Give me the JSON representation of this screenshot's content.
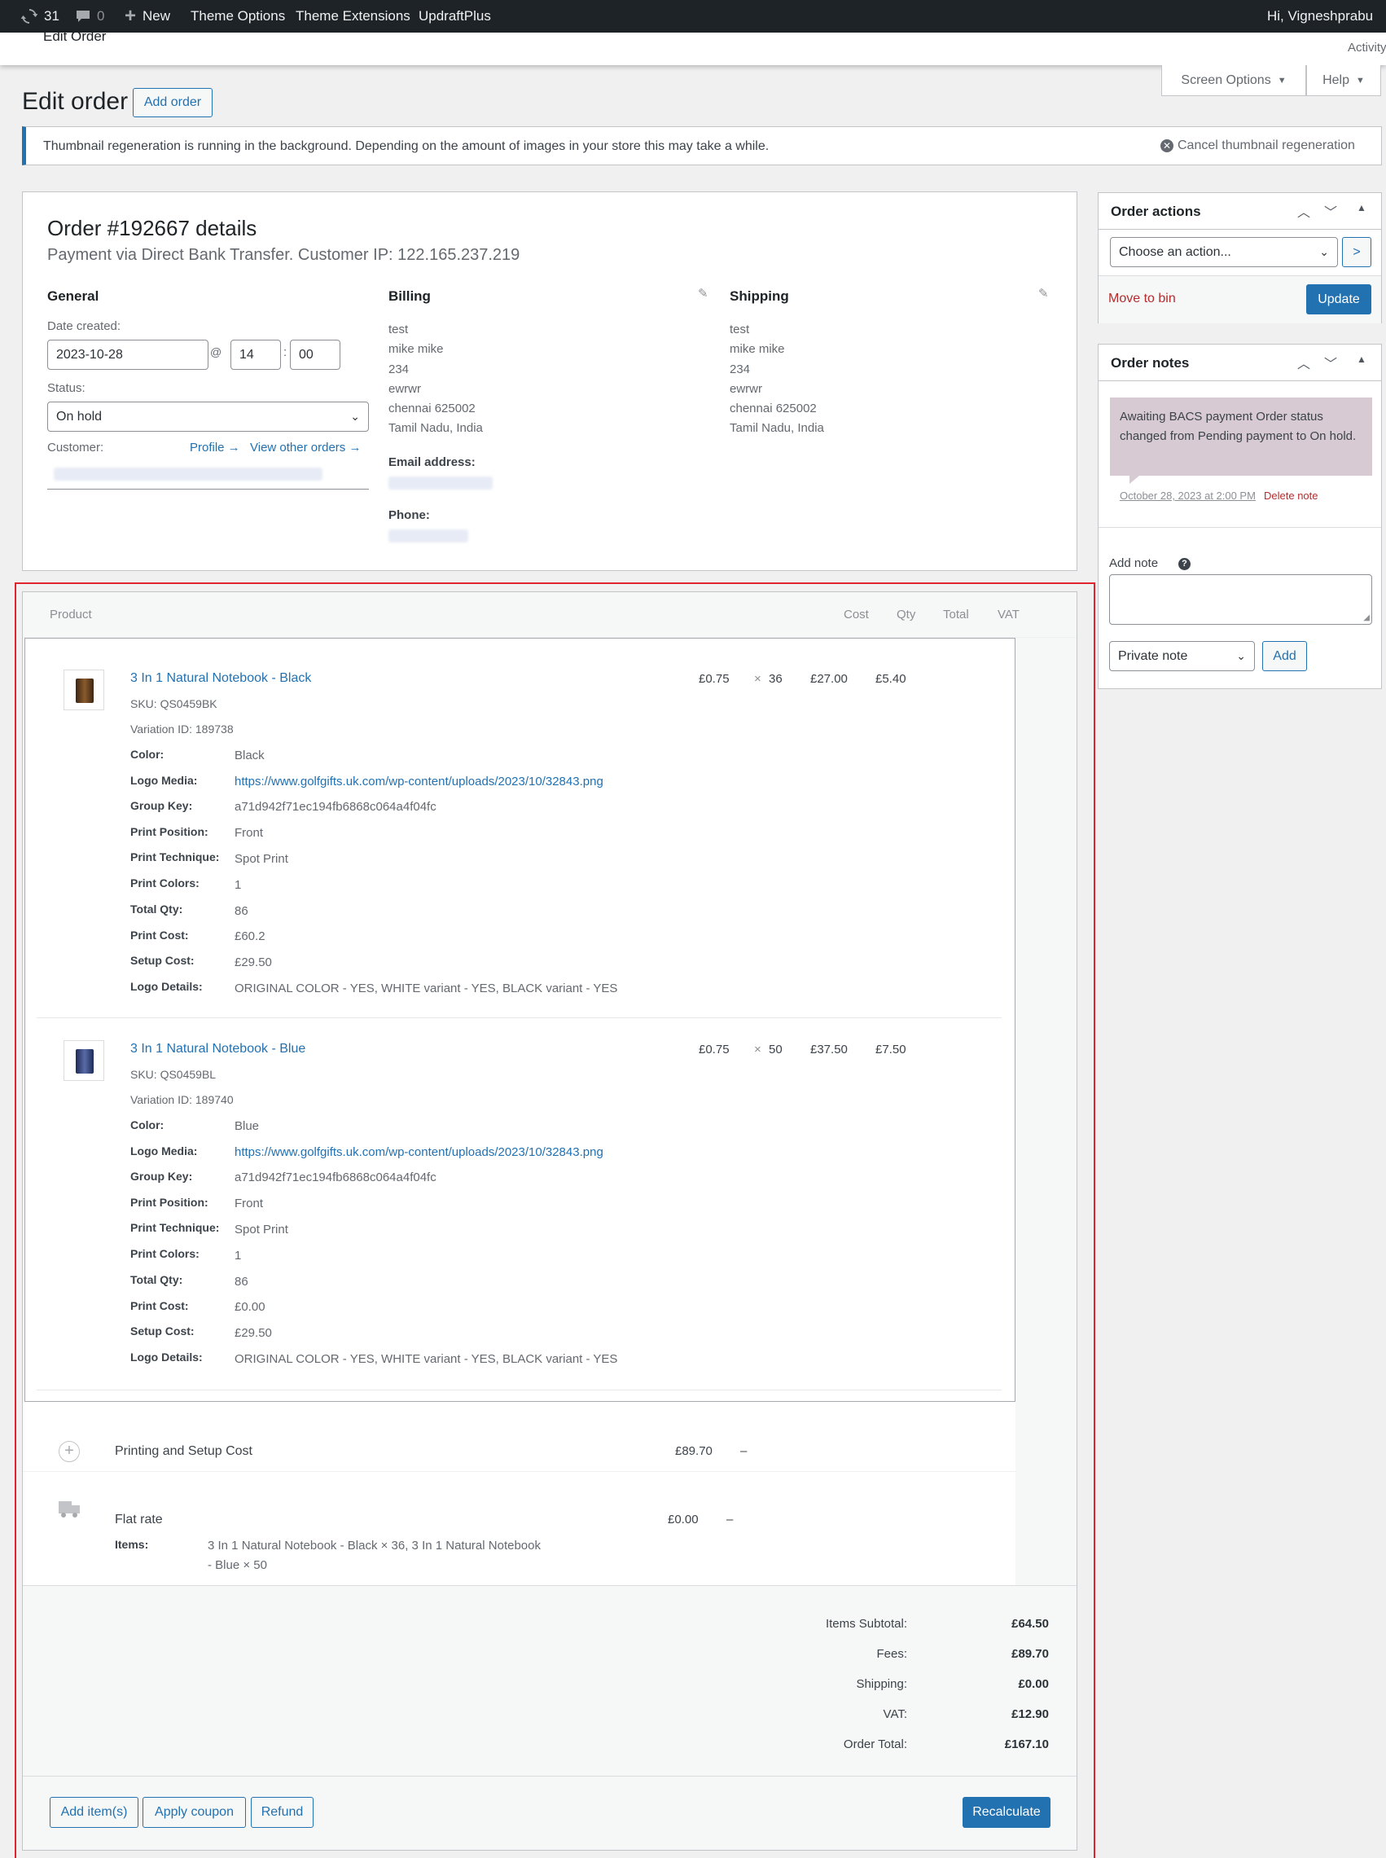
{
  "admin_bar": {
    "updates_count": "31",
    "comments_count": "0",
    "new_label": "New",
    "theme_options": "Theme Options",
    "theme_extensions": "Theme Extensions",
    "updraft": "UpdraftPlus",
    "greeting": "Hi, Vigneshprabu"
  },
  "sub_bar": {
    "title": "Edit Order",
    "activity": "Activity"
  },
  "screen_options": "Screen Options",
  "help": "Help",
  "page_title": "Edit order",
  "add_order": "Add order",
  "notice": {
    "text": "Thumbnail regeneration is running in the background. Depending on the amount of images in your store this may take a while.",
    "cancel": "Cancel thumbnail regeneration"
  },
  "order": {
    "heading": "Order #192667 details",
    "subheading": "Payment via Direct Bank Transfer. Customer IP: 122.165.237.219",
    "general": {
      "title": "General",
      "date_label": "Date created:",
      "date": "2023-10-28",
      "at": "@",
      "hour": "14",
      "colon": ":",
      "minute": "00",
      "status_label": "Status:",
      "status": "On hold",
      "customer_label": "Customer:",
      "profile_link": "Profile →",
      "other_orders_link": "View other orders →"
    },
    "billing": {
      "title": "Billing",
      "lines": [
        "test",
        "mike mike",
        "234",
        "ewrwr",
        "chennai 625002",
        "Tamil Nadu, India"
      ],
      "email_label": "Email address:",
      "phone_label": "Phone:"
    },
    "shipping": {
      "title": "Shipping",
      "lines": [
        "test",
        "mike mike",
        "234",
        "ewrwr",
        "chennai 625002",
        "Tamil Nadu, India"
      ]
    }
  },
  "items_table": {
    "headers": {
      "product": "Product",
      "cost": "Cost",
      "qty": "Qty",
      "total": "Total",
      "vat": "VAT"
    },
    "items": [
      {
        "name": "3 In 1 Natural Notebook - Black",
        "sku_label": "SKU:",
        "sku": "QS0459BK",
        "variation_label": "Variation ID:",
        "variation": "189738",
        "cost": "£0.75",
        "times": "×",
        "qty": "36",
        "total": "£27.00",
        "vat": "£5.40",
        "thumb_color": "#5a3a22",
        "meta": [
          [
            "Color:",
            "Black"
          ],
          [
            "Logo Media:",
            "https://www.golfgifts.uk.com/wp-content/uploads/2023/10/32843.png"
          ],
          [
            "Group Key:",
            "a71d942f71ec194fb6868c064a4f04fc"
          ],
          [
            "Print Position:",
            "Front"
          ],
          [
            "Print Technique:",
            "Spot Print"
          ],
          [
            "Print Colors:",
            "1"
          ],
          [
            "Total Qty:",
            "86"
          ],
          [
            "Print Cost:",
            "£60.2"
          ],
          [
            "Setup Cost:",
            "£29.50"
          ],
          [
            "Logo Details:",
            "ORIGINAL COLOR - YES, WHITE variant - YES, BLACK variant - YES"
          ]
        ]
      },
      {
        "name": "3 In 1 Natural Notebook - Blue",
        "sku_label": "SKU:",
        "sku": "QS0459BL",
        "variation_label": "Variation ID:",
        "variation": "189740",
        "cost": "£0.75",
        "times": "×",
        "qty": "50",
        "total": "£37.50",
        "vat": "£7.50",
        "thumb_color": "#2a3a6a",
        "meta": [
          [
            "Color:",
            "Blue"
          ],
          [
            "Logo Media:",
            "https://www.golfgifts.uk.com/wp-content/uploads/2023/10/32843.png"
          ],
          [
            "Group Key:",
            "a71d942f71ec194fb6868c064a4f04fc"
          ],
          [
            "Print Position:",
            "Front"
          ],
          [
            "Print Technique:",
            "Spot Print"
          ],
          [
            "Print Colors:",
            "1"
          ],
          [
            "Total Qty:",
            "86"
          ],
          [
            "Print Cost:",
            "£0.00"
          ],
          [
            "Setup Cost:",
            "£29.50"
          ],
          [
            "Logo Details:",
            "ORIGINAL COLOR - YES, WHITE variant - YES, BLACK variant - YES"
          ]
        ]
      }
    ],
    "fee": {
      "name": "Printing and Setup Cost",
      "total": "£89.70",
      "vat": "–"
    },
    "shipping": {
      "name": "Flat rate",
      "total": "£0.00",
      "vat": "–",
      "items_label": "Items:",
      "items_line1": "3 In 1 Natural Notebook - Black × 36, 3 In 1 Natural Notebook",
      "items_line2": "- Blue × 50"
    },
    "totals": [
      [
        "Items Subtotal:",
        "£64.50"
      ],
      [
        "Fees:",
        "£89.70"
      ],
      [
        "Shipping:",
        "£0.00"
      ],
      [
        "VAT:",
        "£12.90"
      ],
      [
        "Order Total:",
        "£167.10"
      ]
    ],
    "buttons": {
      "add_items": "Add item(s)",
      "apply_coupon": "Apply coupon",
      "refund": "Refund",
      "recalculate": "Recalculate"
    }
  },
  "order_actions": {
    "title": "Order actions",
    "select": "Choose an action...",
    "go": ">",
    "move_to_bin": "Move to bin",
    "update": "Update"
  },
  "order_notes": {
    "title": "Order notes",
    "note_text": "Awaiting BACS payment Order status changed from Pending payment to On hold.",
    "note_date": "October 28, 2023 at 2:00 PM",
    "delete_note": "Delete note",
    "add_note_label": "Add note",
    "help_icon": "?",
    "note_type": "Private note",
    "add_button": "Add"
  },
  "colors": {
    "accent": "#2271b1",
    "note_bg": "#d7cad2",
    "highlight_border": "#e0242f",
    "admin_bar": "#1d2327"
  }
}
